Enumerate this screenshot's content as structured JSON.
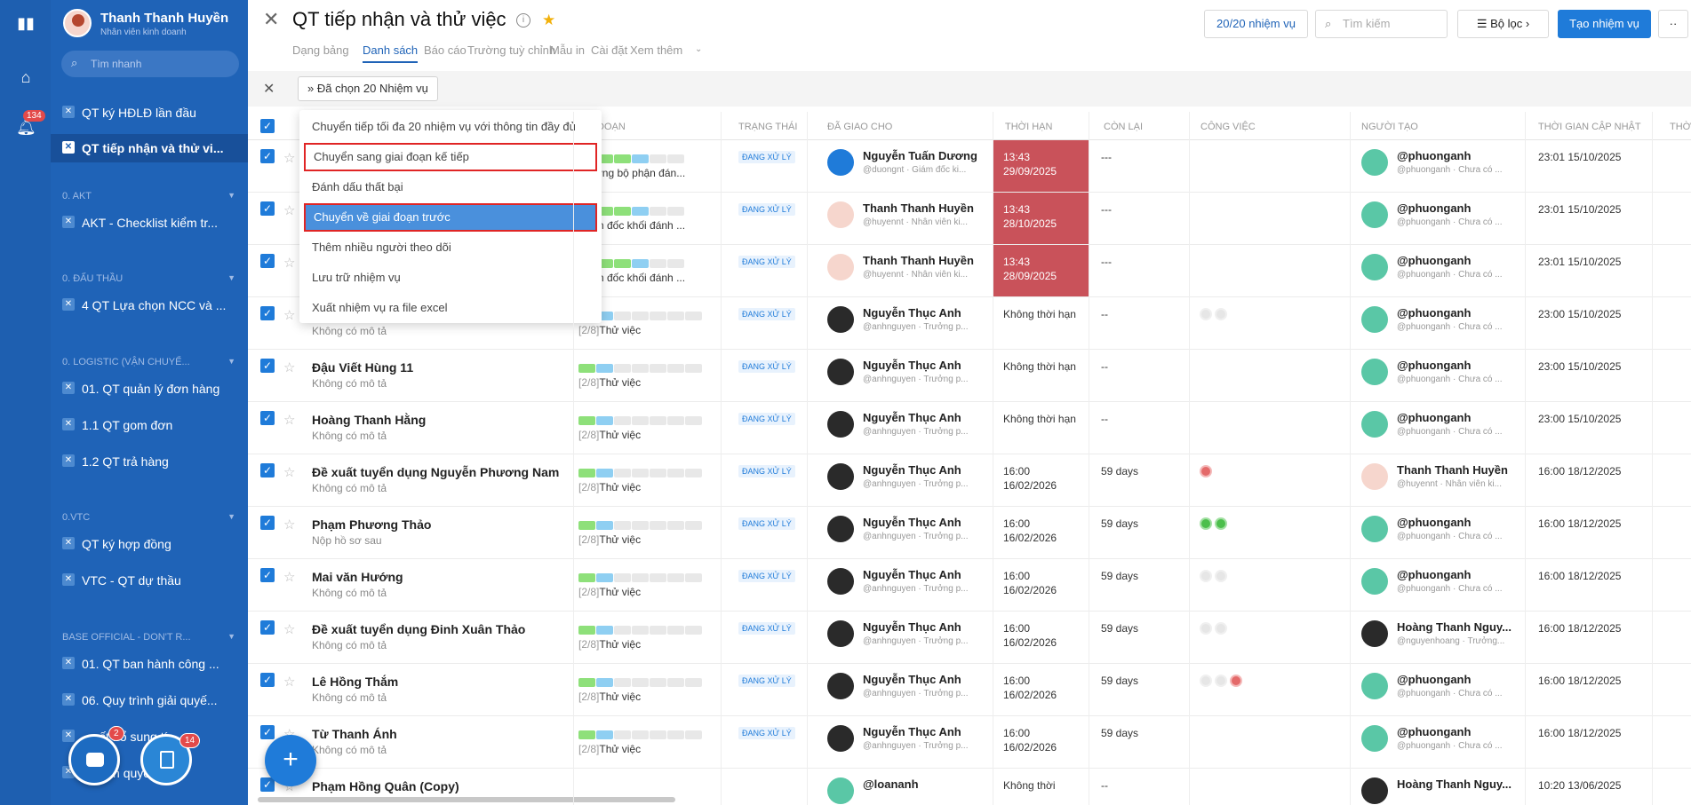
{
  "rail": {
    "notif_count": "134"
  },
  "user": {
    "name": "Thanh Thanh Huyền",
    "role": "Nhân viên kinh doanh"
  },
  "sidebar": {
    "search_placeholder": "Tìm nhanh",
    "items": [
      {
        "label": "QT ký HĐLĐ lần đầu"
      },
      {
        "label": "QT tiếp nhận và thử vi..."
      }
    ],
    "groups": [
      {
        "title": "0. AKT",
        "items": [
          "AKT - Checklist kiểm tr..."
        ]
      },
      {
        "title": "0. ĐẤU THẦU",
        "items": [
          "4 QT Lựa chọn NCC và ..."
        ]
      },
      {
        "title": "0. LOGISTIC (VẬN CHUYỂ...",
        "items": [
          "01. QT quản lý đơn hàng",
          "1.1 QT gom đơn",
          "1.2 QT trả hàng"
        ]
      },
      {
        "title": "0.VTC",
        "items": [
          "QT ký hợp đồng",
          "VTC - QT dự thầu"
        ]
      },
      {
        "title": "BASE OFFICIAL - DON'T R...",
        "items": [
          "01. QT ban hành công ...",
          "06. Quy trình giải quyế...",
          "...uất bổ sung tí...",
          "...hanh quyết toá..."
        ]
      }
    ],
    "chat_badge": "2",
    "task_badge": "14"
  },
  "header": {
    "title": "QT tiếp nhận và thử việc",
    "tabs": [
      "Dạng bảng",
      "Danh sách",
      "Báo cáo",
      "Trường tuỳ chỉnh",
      "Mẫu in",
      "Cài đặt",
      "Xem thêm"
    ],
    "task_count": "20/20 nhiệm vụ",
    "search_placeholder": "Tìm kiếm",
    "filter_label": "Bộ lọc",
    "create_label": "Tạo nhiệm vụ",
    "more_label": "··"
  },
  "toolbar": {
    "selected_label": "Đã chọn 20 Nhiệm vụ"
  },
  "columns": [
    "ĐOẠN",
    "TRẠNG THÁI",
    "ĐÃ GIAO CHO",
    "THỜI HẠN",
    "CÒN LẠI",
    "CÔNG VIỆC",
    "NGƯỜI TẠO",
    "THỜI GIAN CẬP NHẬT",
    "THỜ"
  ],
  "menu": {
    "items": [
      "Chuyển tiếp tối đa 20 nhiệm vụ với thông tin đầy đủ",
      "Chuyển sang giai đoạn kế tiếp",
      "Đánh dấu thất bại",
      "Chuyển về giai đoạn trước",
      "Thêm nhiều người theo dõi",
      "Lưu trữ nhiệm vụ",
      "Xuất nhiệm vụ ra file excel"
    ]
  },
  "rows": [
    {
      "name": "",
      "desc": "",
      "stage": "Trưởng bộ phận đán...",
      "stage_prefix": "",
      "status": "ĐANG XỬ LÝ",
      "assignee": "Nguyễn Tuấn Dương",
      "assignee_sub": "@duongnt · Giám đốc ki...",
      "due": "13:43 29/09/2025",
      "due_red": true,
      "left": "---",
      "creator": "@phuonganh",
      "creator_sub": "@phuonganh · Chưa có ...",
      "updated": "23:01 15/10/2025"
    },
    {
      "name": "",
      "desc": "",
      "stage": "Giám đốc khối đánh ...",
      "stage_prefix": "",
      "status": "ĐANG XỬ LÝ",
      "assignee": "Thanh Thanh Huyền",
      "assignee_sub": "@huyennt · Nhân viên ki...",
      "due": "13:43 28/10/2025",
      "due_red": true,
      "left": "---",
      "creator": "@phuonganh",
      "creator_sub": "@phuonganh · Chưa có ...",
      "updated": "23:01 15/10/2025"
    },
    {
      "name": "",
      "desc": "",
      "stage": "Giám đốc khối đánh ...",
      "stage_prefix": "",
      "status": "ĐANG XỬ LÝ",
      "assignee": "Thanh Thanh Huyền",
      "assignee_sub": "@huyennt · Nhân viên ki...",
      "due": "13:43 28/09/2025",
      "due_red": true,
      "left": "---",
      "creator": "@phuonganh",
      "creator_sub": "@phuonganh · Chưa có ...",
      "updated": "23:01 15/10/2025"
    },
    {
      "name": "",
      "desc": "Không có mô tả",
      "stage": "Thử việc",
      "stage_prefix": "[2/8]",
      "status": "ĐANG XỬ LÝ",
      "assignee": "Nguyễn Thục Anh",
      "assignee_sub": "@anhnguyen · Trưởng p...",
      "due": "Không thời hạn",
      "due_red": false,
      "left": "--",
      "creator": "@phuonganh",
      "creator_sub": "@phuonganh · Chưa có ...",
      "updated": "23:00 15/10/2025"
    },
    {
      "name": "Đậu Viết Hùng 11",
      "desc": "Không có mô tả",
      "stage": "Thử việc",
      "stage_prefix": "[2/8]",
      "status": "ĐANG XỬ LÝ",
      "assignee": "Nguyễn Thục Anh",
      "assignee_sub": "@anhnguyen · Trưởng p...",
      "due": "Không thời hạn",
      "due_red": false,
      "left": "--",
      "creator": "@phuonganh",
      "creator_sub": "@phuonganh · Chưa có ...",
      "updated": "23:00 15/10/2025"
    },
    {
      "name": "Hoàng Thanh Hằng",
      "desc": "Không có mô tả",
      "stage": "Thử việc",
      "stage_prefix": "[2/8]",
      "status": "ĐANG XỬ LÝ",
      "assignee": "Nguyễn Thục Anh",
      "assignee_sub": "@anhnguyen · Trưởng p...",
      "due": "Không thời hạn",
      "due_red": false,
      "left": "--",
      "creator": "@phuonganh",
      "creator_sub": "@phuonganh · Chưa có ...",
      "updated": "23:00 15/10/2025"
    },
    {
      "name": "Đề xuất tuyển dụng Nguyễn Phương Nam",
      "desc": "Không có mô tả",
      "stage": "Thử việc",
      "stage_prefix": "[2/8]",
      "status": "ĐANG XỬ LÝ",
      "assignee": "Nguyễn Thục Anh",
      "assignee_sub": "@anhnguyen · Trưởng p...",
      "due": "16:00 16/02/2026",
      "due_red": false,
      "left": "59 days",
      "creator": "Thanh Thanh Huyền",
      "creator_sub": "@huyennt · Nhân viên ki...",
      "updated": "16:00 18/12/2025"
    },
    {
      "name": "Phạm Phương Thảo",
      "desc": "Nộp hồ sơ sau",
      "stage": "Thử việc",
      "stage_prefix": "[2/8]",
      "status": "ĐANG XỬ LÝ",
      "assignee": "Nguyễn Thục Anh",
      "assignee_sub": "@anhnguyen · Trưởng p...",
      "due": "16:00 16/02/2026",
      "due_red": false,
      "left": "59 days",
      "creator": "@phuonganh",
      "creator_sub": "@phuonganh · Chưa có ...",
      "updated": "16:00 18/12/2025"
    },
    {
      "name": "Mai văn Hướng",
      "desc": "Không có mô tả",
      "stage": "Thử việc",
      "stage_prefix": "[2/8]",
      "status": "ĐANG XỬ LÝ",
      "assignee": "Nguyễn Thục Anh",
      "assignee_sub": "@anhnguyen · Trưởng p...",
      "due": "16:00 16/02/2026",
      "due_red": false,
      "left": "59 days",
      "creator": "@phuonganh",
      "creator_sub": "@phuonganh · Chưa có ...",
      "updated": "16:00 18/12/2025"
    },
    {
      "name": "Đề xuất tuyển dụng Đinh Xuân Thảo",
      "desc": "Không có mô tả",
      "stage": "Thử việc",
      "stage_prefix": "[2/8]",
      "status": "ĐANG XỬ LÝ",
      "assignee": "Nguyễn Thục Anh",
      "assignee_sub": "@anhnguyen · Trưởng p...",
      "due": "16:00 16/02/2026",
      "due_red": false,
      "left": "59 days",
      "creator": "Hoàng Thanh Nguy...",
      "creator_sub": "@nguyenhoang · Trưởng...",
      "updated": "16:00 18/12/2025"
    },
    {
      "name": "Lê Hồng Thắm",
      "desc": "Không có mô tả",
      "stage": "Thử việc",
      "stage_prefix": "[2/8]",
      "status": "ĐANG XỬ LÝ",
      "assignee": "Nguyễn Thục Anh",
      "assignee_sub": "@anhnguyen · Trưởng p...",
      "due": "16:00 16/02/2026",
      "due_red": false,
      "left": "59 days",
      "creator": "@phuonganh",
      "creator_sub": "@phuonganh · Chưa có ...",
      "updated": "16:00 18/12/2025"
    },
    {
      "name": "Từ Thanh Ánh",
      "desc": "Không có mô tả",
      "stage": "Thử việc",
      "stage_prefix": "[2/8]",
      "status": "ĐANG XỬ LÝ",
      "assignee": "Nguyễn Thục Anh",
      "assignee_sub": "@anhnguyen · Trưởng p...",
      "due": "16:00 16/02/2026",
      "due_red": false,
      "left": "59 days",
      "creator": "@phuonganh",
      "creator_sub": "@phuonganh · Chưa có ...",
      "updated": "16:00 18/12/2025"
    },
    {
      "name": "Phạm Hồng Quân (Copy)",
      "desc": "",
      "stage": "",
      "stage_prefix": "",
      "status": "",
      "assignee": "@loananh",
      "assignee_sub": "",
      "due": "Không thời",
      "due_red": false,
      "left": "--",
      "creator": "Hoàng Thanh Nguy...",
      "creator_sub": "",
      "updated": "10:20 13/06/2025"
    }
  ]
}
